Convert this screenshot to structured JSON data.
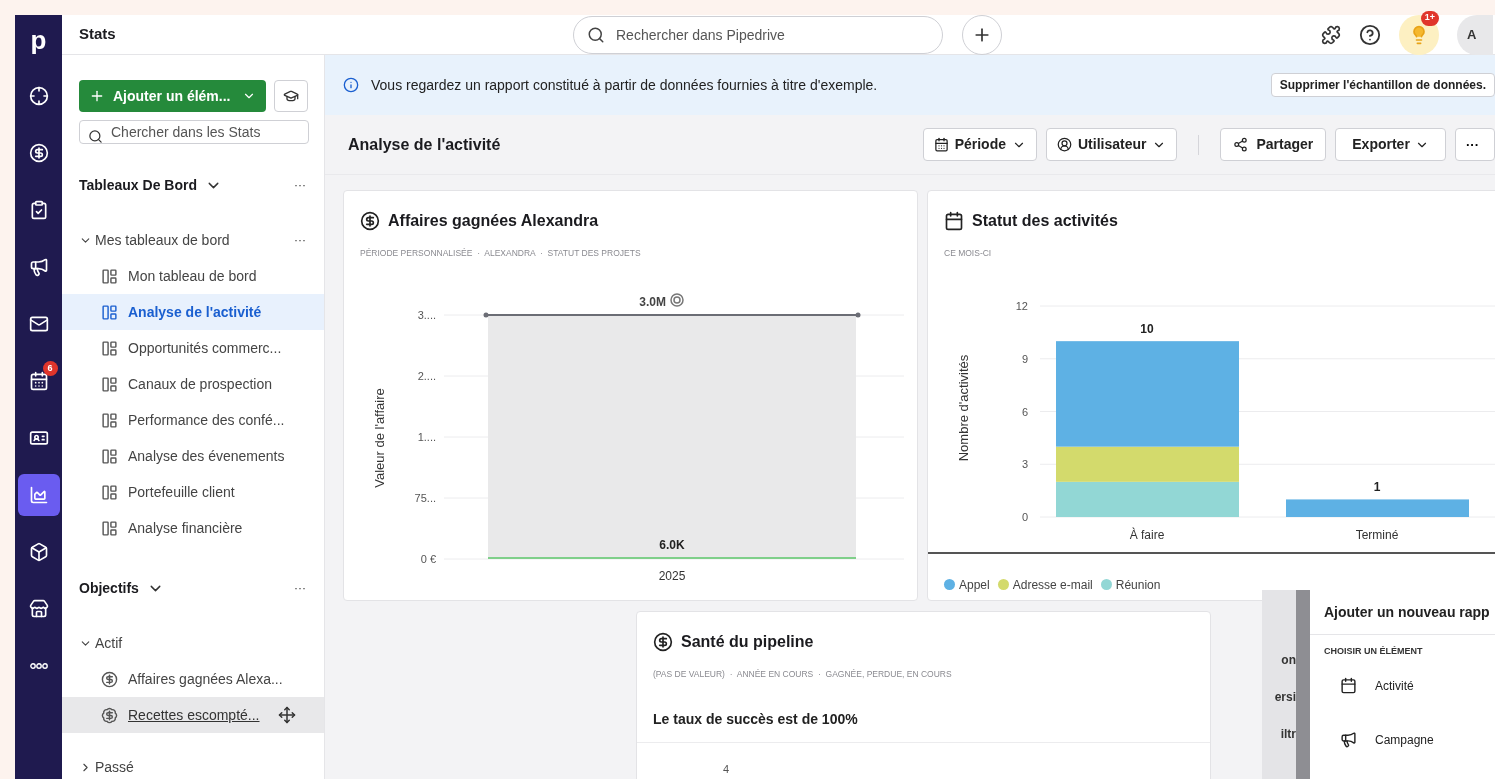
{
  "rail": {
    "logo": "p",
    "items": [
      {
        "selected": false
      },
      {
        "selected": false
      },
      {
        "selected": false
      },
      {
        "selected": false
      },
      {
        "selected": false
      },
      {
        "selected": false,
        "badge": "6"
      },
      {
        "selected": false
      },
      {
        "selected": true
      },
      {
        "selected": false
      },
      {
        "selected": false
      },
      {
        "selected": false
      }
    ]
  },
  "topbar": {
    "title": "Stats",
    "search": {
      "placeholder": "Rechercher dans Pipedrive"
    },
    "tips_badge": "1+",
    "avatar": "A"
  },
  "sidebar": {
    "add_button": "Ajouter un élém...",
    "search": {
      "placeholder": "Chercher dans les Stats"
    },
    "sections": [
      {
        "title": "Tableaux De Bord",
        "menu": "···",
        "groups": [
          {
            "label": "Mes tableaux de bord",
            "expanded": true,
            "menu": "···",
            "children": [
              {
                "label": "Mon tableau de bord",
                "kind": "dashboard",
                "selected": false,
                "hovered": false
              },
              {
                "label": "Analyse de l'activité",
                "kind": "dashboard",
                "selected": true,
                "hovered": false
              },
              {
                "label": "Opportunités commerc...",
                "kind": "dashboard",
                "selected": false,
                "hovered": false
              },
              {
                "label": "Canaux de prospection",
                "kind": "dashboard",
                "selected": false,
                "hovered": false
              },
              {
                "label": "Performance des confé...",
                "kind": "dashboard",
                "selected": false,
                "hovered": false
              },
              {
                "label": "Analyse des évenements",
                "kind": "dashboard",
                "selected": false,
                "hovered": false
              },
              {
                "label": "Portefeuille client",
                "kind": "dashboard",
                "selected": false,
                "hovered": false
              },
              {
                "label": "Analyse financière",
                "kind": "dashboard",
                "selected": false,
                "hovered": false
              }
            ]
          }
        ]
      },
      {
        "title": "Objectifs",
        "menu": "···",
        "groups": [
          {
            "label": "Actif",
            "expanded": true,
            "children": [
              {
                "label": "Affaires gagnées Alexa...",
                "kind": "goal",
                "selected": false,
                "hovered": false
              },
              {
                "label": "Recettes escompté...",
                "kind": "revenue",
                "selected": false,
                "hovered": true
              }
            ]
          },
          {
            "label": "Passé",
            "expanded": false
          }
        ]
      }
    ]
  },
  "banner": {
    "text": "Vous regardez un rapport constitué à partir de données fournies à titre d'exemple.",
    "button": "Supprimer l'échantillon de données."
  },
  "header": {
    "title": "Analyse de l'activité",
    "filters": [
      "Période",
      "Utilisateur"
    ],
    "share": "Partager",
    "export": "Exporter",
    "more": "···"
  },
  "cards": [
    {
      "title": "Affaires gagnées Alexandra",
      "meta": "PÉRIODE PERSONNALISÉE  ·  ALEXANDRA  ·  STATUT DES PROJETS",
      "goal_chart": {
        "axis_title": "Valeur de l'affaire",
        "y_tick_labels": [
          "3....",
          "2....",
          "1....",
          "75...",
          "0 €"
        ],
        "goal_label": "3.0M",
        "value_label": "6.0K",
        "x_label": "2025"
      }
    },
    {
      "title": "Statut des activités",
      "meta": "CE MOIS-CI",
      "chart_data": {
        "type": "bar",
        "stacked": true,
        "grid": true,
        "ylabel": "Nombre d'activités",
        "categories": [
          "À faire",
          "Terminé"
        ],
        "series": [
          {
            "name": "Appel",
            "color": "#5eb1e4",
            "values": [
              6,
              1
            ]
          },
          {
            "name": "Adresse e-mail",
            "color": "#d3da6c",
            "values": [
              2,
              0
            ]
          },
          {
            "name": "Réunion",
            "color": "#92d7d5",
            "values": [
              2,
              0
            ]
          }
        ],
        "ylim": [
          0,
          12
        ],
        "yticks": [
          0,
          3,
          6,
          9,
          12
        ],
        "value_labels": [
          "10",
          "1"
        ]
      }
    }
  ],
  "pipeline_card": {
    "title": "Santé du pipeline",
    "meta": "(PAS DE VALEUR)  ·  ANNÉE EN COURS  ·  GAGNÉE, PERDUE, EN COURS",
    "subtitle": "Le taux de succès est de 100%",
    "axis_tick": "4"
  },
  "background_fragments": [
    "on",
    "ersi",
    "iltr"
  ],
  "popover": {
    "title": "Ajouter un nouveau rapp",
    "section": "CHOISIR UN ÉLÉMENT",
    "items": [
      {
        "label": "Activité",
        "kind": "activity"
      },
      {
        "label": "Campagne",
        "kind": "campaign"
      }
    ]
  }
}
